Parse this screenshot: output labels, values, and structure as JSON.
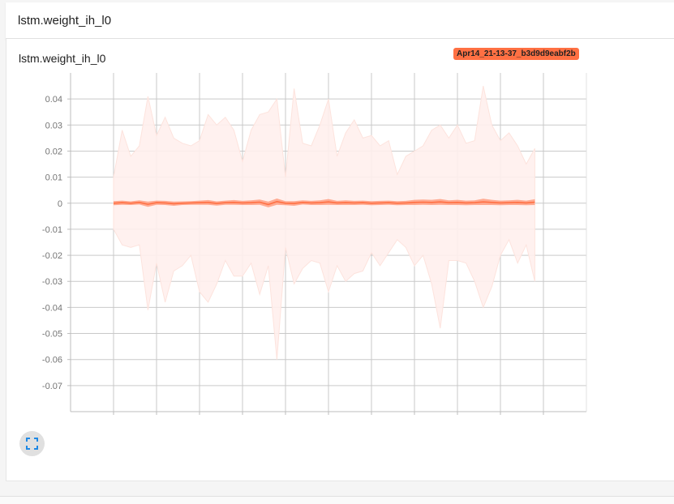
{
  "header": {
    "title": "lstm.weight_ih_l0"
  },
  "card": {
    "title": "lstm.weight_ih_l0",
    "run_badge": "Apr14_21-13-37_b3d9d9eabf2b"
  },
  "colors": {
    "band": "#fff0ed",
    "band_stroke": "#fde3dd",
    "line": "#ff7043",
    "badge": "#ff7043"
  },
  "icons": {
    "expand": "fullscreen-icon"
  },
  "chart_data": {
    "type": "area",
    "title": "lstm.weight_ih_l0",
    "xlabel": "",
    "ylabel": "",
    "xlim": [
      -5,
      55
    ],
    "ylim": [
      -0.08,
      0.05
    ],
    "xticks": [
      "0",
      "5",
      "10",
      "15",
      "20",
      "25",
      "30",
      "35",
      "40",
      "45",
      "50"
    ],
    "yticks": [
      "0.04",
      "0.03",
      "0.02",
      "0.01",
      "0",
      "-0.01",
      "-0.02",
      "-0.03",
      "-0.04",
      "-0.05",
      "-0.06",
      "-0.07"
    ],
    "grid": true,
    "legend": "none",
    "series": [
      {
        "x": [
          0,
          1,
          2,
          3,
          4,
          5,
          6,
          7,
          8,
          9,
          10,
          11,
          12,
          13,
          14,
          15,
          16,
          17,
          18,
          19,
          20,
          21,
          22,
          23,
          24,
          25,
          26,
          27,
          28,
          29,
          30,
          31,
          32,
          33,
          34,
          35,
          36,
          37,
          38,
          39,
          40,
          41,
          42,
          43,
          44,
          45,
          46,
          47,
          48,
          49
        ],
        "max": [
          0.01,
          0.028,
          0.018,
          0.022,
          0.041,
          0.026,
          0.033,
          0.025,
          0.023,
          0.022,
          0.024,
          0.034,
          0.03,
          0.033,
          0.028,
          0.016,
          0.028,
          0.034,
          0.035,
          0.04,
          0.01,
          0.044,
          0.023,
          0.022,
          0.03,
          0.04,
          0.018,
          0.027,
          0.032,
          0.025,
          0.026,
          0.022,
          0.024,
          0.011,
          0.018,
          0.02,
          0.022,
          0.028,
          0.03,
          0.025,
          0.03,
          0.023,
          0.024,
          0.045,
          0.03,
          0.024,
          0.027,
          0.022,
          0.015,
          0.021
        ],
        "min": [
          -0.01,
          -0.016,
          -0.017,
          -0.016,
          -0.041,
          -0.023,
          -0.038,
          -0.026,
          -0.024,
          -0.02,
          -0.034,
          -0.038,
          -0.031,
          -0.022,
          -0.028,
          -0.028,
          -0.023,
          -0.035,
          -0.024,
          -0.06,
          -0.017,
          -0.031,
          -0.025,
          -0.022,
          -0.023,
          -0.034,
          -0.024,
          -0.03,
          -0.027,
          -0.026,
          -0.019,
          -0.024,
          -0.019,
          -0.014,
          -0.017,
          -0.024,
          -0.02,
          -0.031,
          -0.048,
          -0.022,
          -0.022,
          -0.023,
          -0.03,
          -0.04,
          -0.032,
          -0.02,
          -0.014,
          -0.023,
          -0.016,
          -0.03
        ],
        "median": [
          0.0,
          0.0002,
          0.0,
          0.0003,
          -0.0004,
          0.0002,
          0.0001,
          -0.0002,
          0.0,
          0.0001,
          0.0002,
          0.0003,
          -0.0001,
          0.0002,
          0.0003,
          0.0001,
          0.0002,
          0.0004,
          -0.0005,
          0.0006,
          0.0,
          -0.0001,
          0.0003,
          0.0001,
          0.0002,
          0.0005,
          0.0001,
          0.0002,
          0.0001,
          0.0002,
          0.0,
          0.0001,
          0.0002,
          0.0,
          0.0001,
          0.0003,
          0.0004,
          0.0003,
          0.0005,
          0.0002,
          0.0003,
          0.0001,
          0.0002,
          0.0005,
          0.0003,
          0.0001,
          0.0002,
          0.0003,
          0.0001,
          0.0004
        ],
        "inner_width": [
          0.0008,
          0.0008,
          0.0007,
          0.0008,
          0.001,
          0.0008,
          0.0008,
          0.0008,
          0.0007,
          0.0007,
          0.0008,
          0.0009,
          0.0008,
          0.0008,
          0.0009,
          0.0008,
          0.0009,
          0.001,
          0.0011,
          0.0012,
          0.0008,
          0.0009,
          0.0008,
          0.0008,
          0.0009,
          0.0011,
          0.0008,
          0.0009,
          0.0008,
          0.0008,
          0.0008,
          0.0008,
          0.0008,
          0.0008,
          0.0008,
          0.001,
          0.001,
          0.001,
          0.0011,
          0.0009,
          0.001,
          0.0009,
          0.0009,
          0.0012,
          0.001,
          0.0009,
          0.0009,
          0.001,
          0.0009,
          0.0011
        ]
      }
    ]
  }
}
